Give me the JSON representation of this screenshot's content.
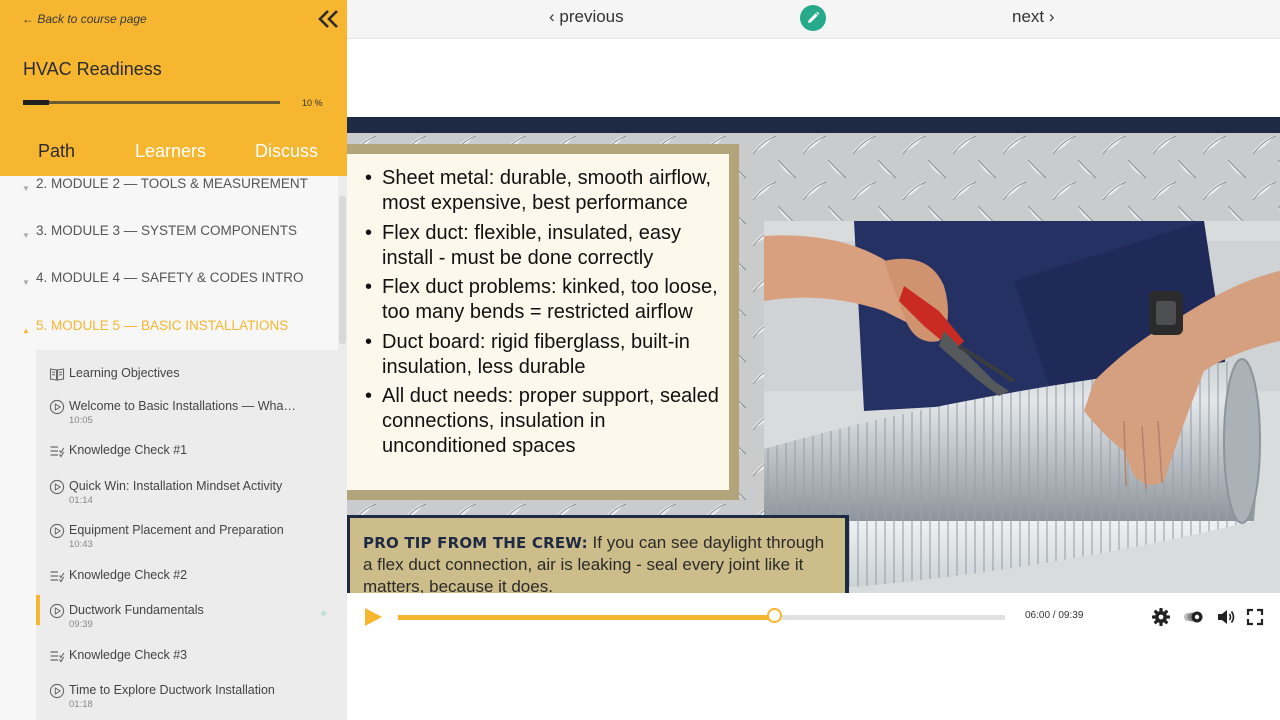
{
  "sidebar": {
    "back_label": "← Back to course page",
    "course_title": "HVAC Readiness",
    "progress": {
      "percent": 10,
      "label": "10 %"
    },
    "tabs": [
      {
        "label": "Path",
        "active": true
      },
      {
        "label": "Learners",
        "active": false
      },
      {
        "label": "Discuss",
        "active": false
      }
    ],
    "modules": [
      {
        "label": "2. MODULE 2 — TOOLS & MEASUREMENT"
      },
      {
        "label": "3. MODULE 3 — SYSTEM COMPONENTS"
      },
      {
        "label": "4. MODULE 4 — SAFETY & CODES INTRO"
      },
      {
        "label": "5. MODULE 5 — BASIC INSTALLATIONS",
        "active": true
      }
    ],
    "lessons": [
      {
        "title": "Learning Objectives",
        "icon": "book-icon",
        "time": ""
      },
      {
        "title": "Welcome to Basic Installations — What to Expect",
        "icon": "play-circle-icon",
        "time": "10:05"
      },
      {
        "title": "Knowledge Check #1",
        "icon": "checklist-icon",
        "time": ""
      },
      {
        "title": "Quick Win: Installation Mindset Activity",
        "icon": "play-circle-icon",
        "time": "01:14"
      },
      {
        "title": "Equipment Placement and Preparation",
        "icon": "play-circle-icon",
        "time": "10:43"
      },
      {
        "title": "Knowledge Check #2",
        "icon": "checklist-icon",
        "time": ""
      },
      {
        "title": "Ductwork Fundamentals",
        "icon": "play-circle-icon",
        "time": "09:39",
        "current": true
      },
      {
        "title": "Knowledge Check #3",
        "icon": "checklist-icon",
        "time": ""
      },
      {
        "title": "Time to Explore Ductwork Installation",
        "icon": "play-circle-icon",
        "time": "01:18"
      }
    ]
  },
  "nav": {
    "previous_label": "‹ previous",
    "next_label": "next ›"
  },
  "slide": {
    "bullets": [
      "Sheet metal: durable, smooth airflow, most expensive, best performance",
      "Flex duct: flexible, insulated, easy install - must be done correctly",
      "Flex duct problems: kinked, too loose, too many bends = restricted airflow",
      "Duct board: rigid fiberglass, built-in insulation, less durable",
      "All duct needs: proper support, sealed connections, insulation in unconditioned spaces"
    ],
    "tip_heading": "PRO TIP FROM THE CREW:",
    "tip_text": "If you can see daylight through a flex duct connection, air is leaking - seal every joint like it matters, because it does."
  },
  "player": {
    "current_time": "06:00",
    "duration": "09:39",
    "time_label": "06:00 / 09:39",
    "progress_fraction": 0.621
  },
  "colors": {
    "accent": "#f6b62f",
    "teal": "#27a98c",
    "navy": "#1e2a44"
  }
}
